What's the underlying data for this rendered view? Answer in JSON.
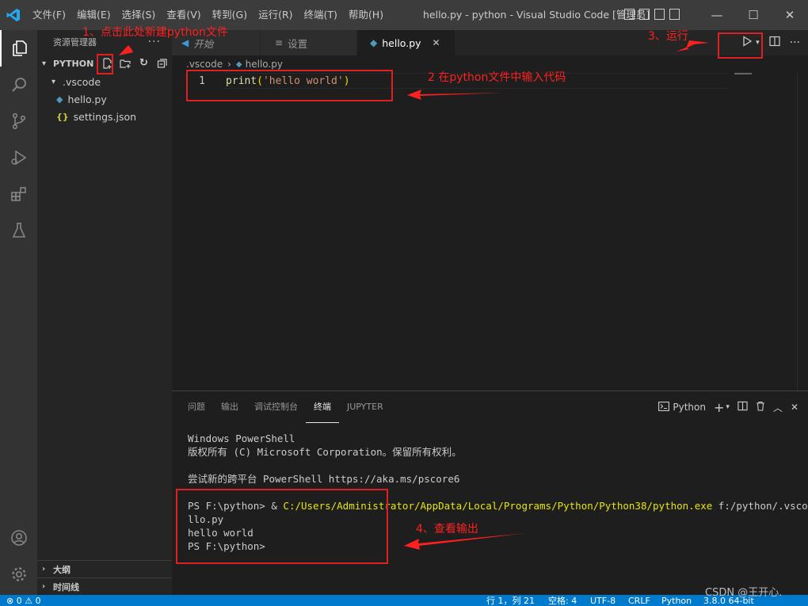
{
  "titlebar": {
    "menu": [
      "文件(F)",
      "编辑(E)",
      "选择(S)",
      "查看(V)",
      "转到(G)",
      "运行(R)",
      "终端(T)",
      "帮助(H)"
    ],
    "window_title": "hello.py - python - Visual Studio Code [管理员]"
  },
  "sidebar": {
    "header": "资源管理器",
    "folder": "PYTHON",
    "tree": [
      ".vscode",
      "hello.py",
      "settings.json"
    ],
    "outline": "大纲",
    "timeline": "时间线"
  },
  "tabs": [
    {
      "label": "开始",
      "active": false
    },
    {
      "label": "设置",
      "active": false
    },
    {
      "label": "hello.py",
      "active": true
    }
  ],
  "breadcrumb": [
    ".vscode",
    "hello.py"
  ],
  "editor": {
    "line_number": "1",
    "code_fn": "print",
    "code_open": "(",
    "code_str": "'hello world'",
    "code_close": ")"
  },
  "panel": {
    "tabs": [
      "问题",
      "输出",
      "调试控制台",
      "终端",
      "JUPYTER"
    ],
    "active_tab": "终端",
    "shell_label": "Python",
    "terminal": {
      "l1": "Windows PowerShell",
      "l2": "版权所有 (C) Microsoft Corporation。保留所有权利。",
      "l3": "尝试新的跨平台 PowerShell https://aka.ms/pscore6",
      "l4_prompt": "PS F:\\python> & ",
      "l4_path": "C:/Users/Administrator/AppData/Local/Programs/Python/Python38/python.exe",
      "l4_rest": " f:/python/.vscode/he",
      "l5": "llo.py",
      "l6": "hello world",
      "l7": "PS F:\\python>"
    }
  },
  "statusbar": {
    "problems": "⊗ 0  ⚠ 0",
    "position": "行 1，列 21",
    "spaces": "空格: 4",
    "encoding": "UTF-8",
    "eol": "CRLF",
    "language": "Python",
    "interpreter": "3.8.0 64-bit"
  },
  "annotations": {
    "step1": "1、点击此处新建python文件",
    "step2": "2  在python文件中输入代码",
    "step3": "3、运行",
    "step4": "4、查看输出"
  },
  "watermark": "CSDN @王开心."
}
